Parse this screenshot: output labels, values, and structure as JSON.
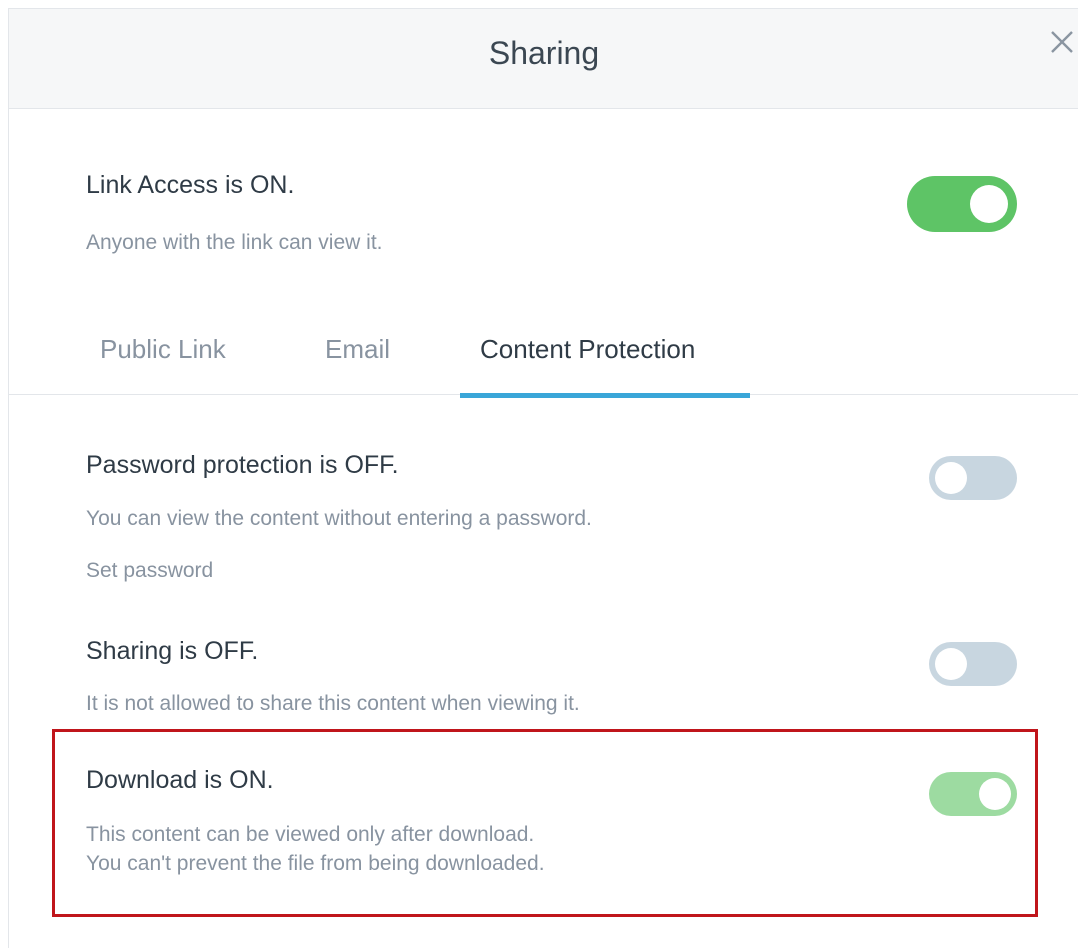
{
  "header": {
    "title": "Sharing",
    "close_icon": "close-icon"
  },
  "link_access": {
    "title": "Link Access is ON.",
    "subtitle": "Anyone with the link can view it.",
    "toggle_on": true
  },
  "tabs": [
    {
      "label": "Public Link",
      "active": false
    },
    {
      "label": "Email",
      "active": false
    },
    {
      "label": "Content Protection",
      "active": true
    }
  ],
  "password": {
    "title": "Password protection is OFF.",
    "subtitle": "You can view the content without entering a password.",
    "link": "Set password",
    "toggle_on": false
  },
  "sharing": {
    "title": "Sharing is OFF.",
    "subtitle": "It is not allowed to share this content when viewing it.",
    "toggle_on": false
  },
  "download": {
    "title": "Download is ON.",
    "subtitle_line1": "This content can be viewed only after download.",
    "subtitle_line2": "You can't prevent the file from being downloaded.",
    "toggle_on": true
  },
  "colors": {
    "toggle_on_primary": "#5ec466",
    "toggle_on_muted": "#9ddba1",
    "toggle_off": "#c8d6e0",
    "tab_active_underline": "#3aa6d8",
    "highlight_border": "#c0151b"
  }
}
